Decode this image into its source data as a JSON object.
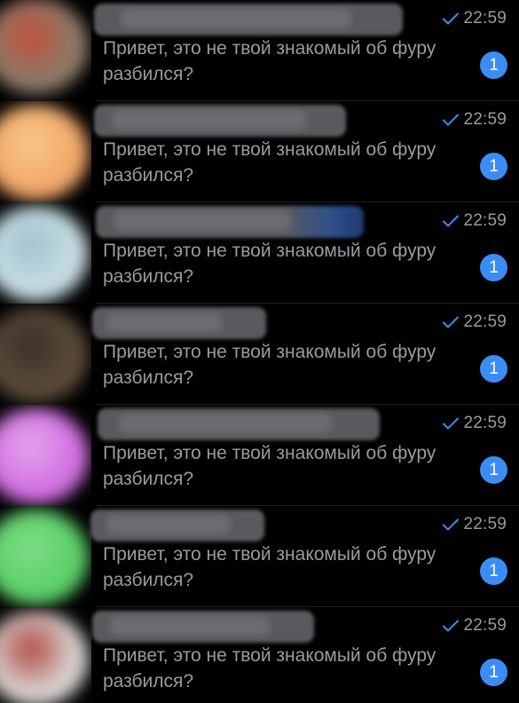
{
  "chats": [
    {
      "preview": "Привет, это не твой знакомый об фуру разбился?",
      "time": "22:59",
      "unread": "1",
      "avatar_color": "#8c7a6a",
      "avatar_color_2": "#c0503a",
      "status_icon": "sent-check-icon"
    },
    {
      "preview": "Привет, это не твой знакомый об фуру разбился?",
      "time": "22:59",
      "unread": "1",
      "avatar_color": "#f2a86a",
      "avatar_color_2": "#f6c888",
      "status_icon": "sent-check-icon"
    },
    {
      "preview": "Привет, это не твой знакомый об фуру разбился?",
      "time": "22:59",
      "unread": "1",
      "avatar_color": "#c8dde4",
      "avatar_color_2": "#9fc2cc",
      "status_icon": "sent-check-icon"
    },
    {
      "preview": "Привет, это не твой знакомый об фуру разбился?",
      "time": "22:59",
      "unread": "1",
      "avatar_color": "#5a4a3a",
      "avatar_color_2": "#3a3028",
      "status_icon": "sent-check-icon"
    },
    {
      "preview": "Привет, это не твой знакомый об фуру разбился?",
      "time": "22:59",
      "unread": "1",
      "avatar_color": "#d070e0",
      "avatar_color_2": "#e6a6ee",
      "status_icon": "sent-check-icon"
    },
    {
      "preview": "Привет, это не твой знакомый об фуру разбился?",
      "time": "22:59",
      "unread": "1",
      "avatar_color": "#5ccf6a",
      "avatar_color_2": "#7ede86",
      "status_icon": "sent-check-icon"
    },
    {
      "preview": "Привет, это не твой знакомый об фуру разбился?",
      "time": "22:59",
      "unread": "1",
      "avatar_color": "#d8d4d2",
      "avatar_color_2": "#b04a44",
      "status_icon": "sent-check-icon"
    }
  ],
  "colors": {
    "background": "#000000",
    "accent": "#3c8cf5",
    "secondary_text": "#9a9aa0"
  }
}
